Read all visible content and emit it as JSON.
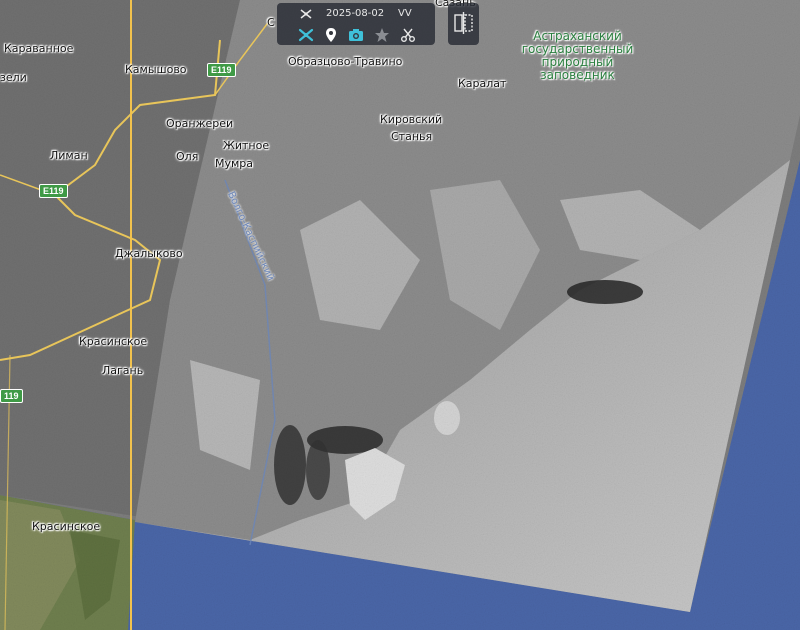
{
  "toolbar": {
    "date": "2025-08-02",
    "polarization": "VV",
    "icons": [
      "satellite-icon",
      "layers-tool-icon",
      "pin-icon",
      "camera-icon",
      "star-icon",
      "scissors-icon"
    ],
    "accent": "#3fc1d9"
  },
  "compare": {
    "icon": "split-view-icon"
  },
  "places": {
    "karavannoe": "Караванное",
    "zeli": "зели",
    "kamyshovo": "Камышово",
    "oranzherei": "Оранжереи",
    "olya": "Оля",
    "liman": "Лиман",
    "zhitnoe": "Житное",
    "mumra": "Мумра",
    "dzhalykovo": "Джалыково",
    "krasinskoe": "Красинское",
    "lagan": "Лагань",
    "krasinskoe2": "Красинское",
    "obraztsovo": "Образцово-Травино",
    "karalat": "Каралат",
    "kirovsky": "Кировский",
    "stanya": "Станья",
    "sazan": "Сазань",
    "s_top": "С",
    "canal": "Волго-Каспийский"
  },
  "reserve": {
    "line1": "Астраханский",
    "line2": "государственный",
    "line3": "природный",
    "line4": "заповедник"
  },
  "roads": {
    "r1": "E119",
    "r2": "E119",
    "r3": "119"
  },
  "colors": {
    "sea": "#4a66a8",
    "boundary": "#f2c24d",
    "road": "#e8c55a"
  }
}
